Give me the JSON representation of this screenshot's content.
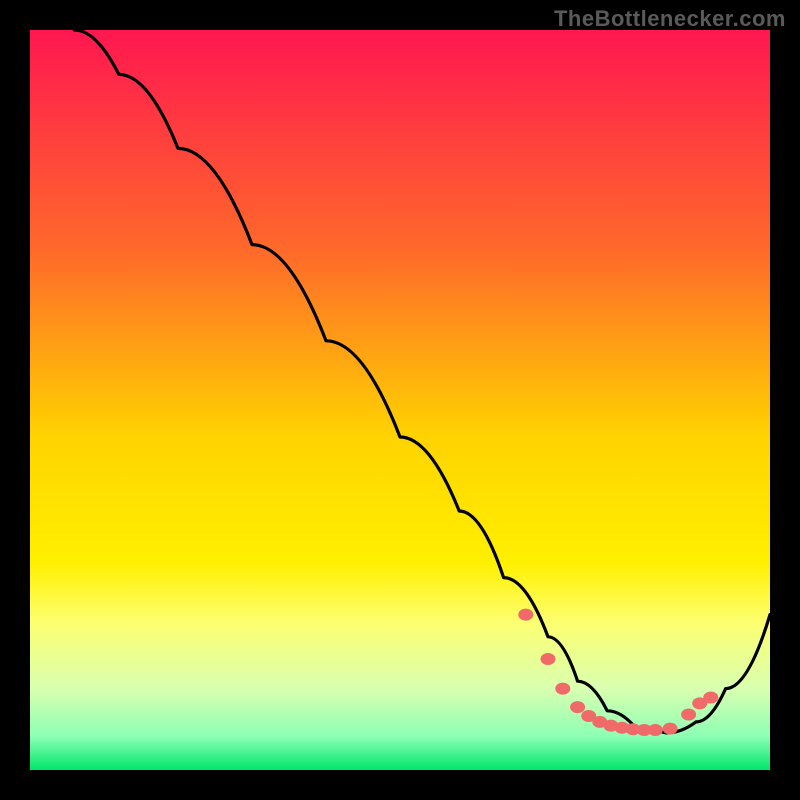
{
  "watermark": "TheBottlenecker.com",
  "chart_data": {
    "type": "line",
    "title": "",
    "xlabel": "",
    "ylabel": "",
    "xlim": [
      0,
      100
    ],
    "ylim": [
      0,
      100
    ],
    "grid": false,
    "legend": false,
    "gradient_stops": [
      {
        "offset": 0,
        "color": "#ff1750"
      },
      {
        "offset": 0.3,
        "color": "#ff6a2a"
      },
      {
        "offset": 0.55,
        "color": "#ffd300"
      },
      {
        "offset": 0.72,
        "color": "#fff000"
      },
      {
        "offset": 0.8,
        "color": "#fdff70"
      },
      {
        "offset": 0.89,
        "color": "#d9ffb0"
      },
      {
        "offset": 0.955,
        "color": "#8cffb4"
      },
      {
        "offset": 1.0,
        "color": "#00e66a"
      }
    ],
    "curve": {
      "x": [
        6,
        12,
        20,
        30,
        40,
        50,
        58,
        64,
        70,
        74,
        78,
        82,
        86,
        90,
        94,
        100
      ],
      "y": [
        100,
        94,
        84,
        71,
        58,
        45,
        35,
        26,
        18,
        12,
        8,
        5.5,
        5,
        6.5,
        11,
        21
      ]
    },
    "dots": {
      "x": [
        67,
        70,
        72,
        74,
        75.5,
        77,
        78.5,
        80,
        81.5,
        83,
        84.5,
        86.5,
        89,
        90.5,
        92
      ],
      "y": [
        21,
        15,
        11,
        8.5,
        7.3,
        6.5,
        6.0,
        5.7,
        5.5,
        5.4,
        5.4,
        5.6,
        7.5,
        9.0,
        9.8
      ],
      "color": "#f06a6a",
      "r": 6
    }
  }
}
